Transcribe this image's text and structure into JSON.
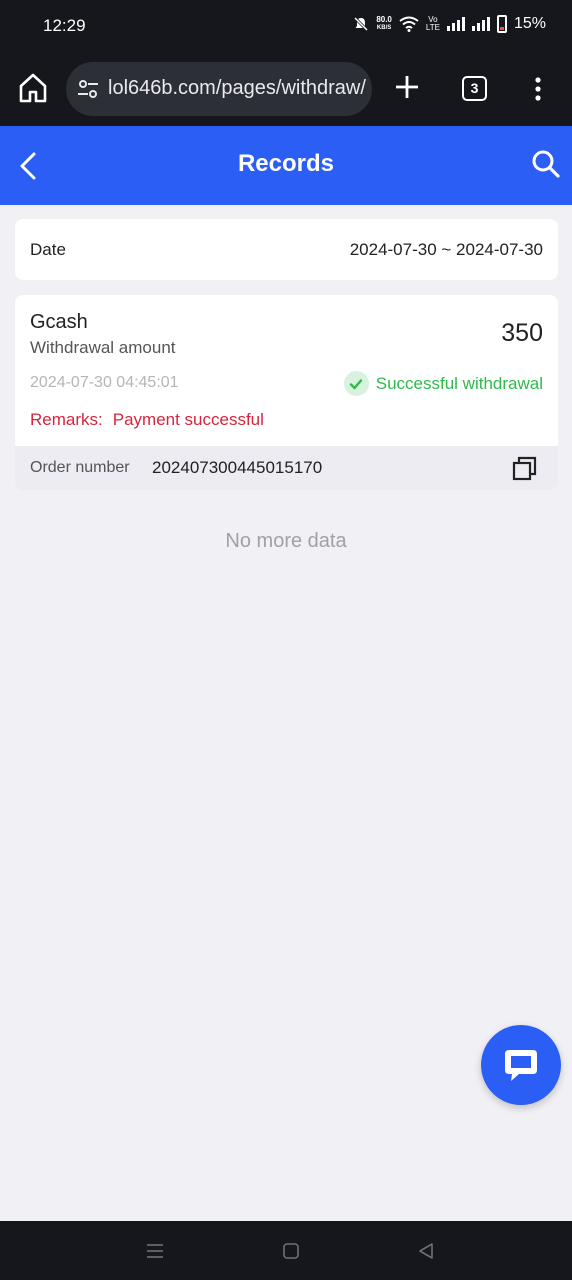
{
  "status_bar": {
    "time": "12:29",
    "net_speed_value": "80.0",
    "net_speed_unit": "KB/S",
    "volte_top": "Vo",
    "volte_bottom": "LTE",
    "battery": "15%",
    "icons": [
      "mute-icon",
      "wifi-icon",
      "signal-icon",
      "battery-icon"
    ]
  },
  "browser": {
    "url": "lol646b.com/pages/withdraw/",
    "tab_count": "3"
  },
  "header": {
    "title": "Records"
  },
  "filter": {
    "date_label": "Date",
    "date_range": "2024-07-30 ~ 2024-07-30"
  },
  "record": {
    "method": "Gcash",
    "amount_label": "Withdrawal amount",
    "amount": "350",
    "timestamp": "2024-07-30 04:45:01",
    "status": "Successful withdrawal",
    "remarks_label": "Remarks:",
    "remarks_value": "Payment successful",
    "order_label": "Order number",
    "order_number": "202407300445015170"
  },
  "list_end": "No more data",
  "colors": {
    "accent": "#2a5ef5",
    "success": "#2dbb4c",
    "remarks": "#d6263d",
    "background": "#f0f0f5"
  }
}
